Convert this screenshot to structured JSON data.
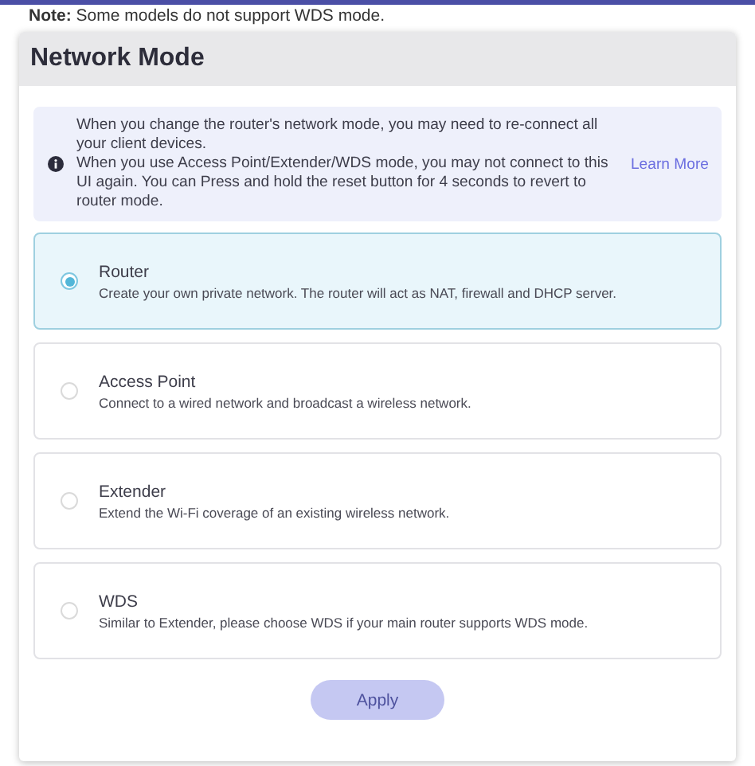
{
  "note": "**Note:** Some models do not support WDS mode.",
  "panel": {
    "title": "Network Mode"
  },
  "info": {
    "lines": [
      "When you change the router's network mode, you may need to re-connect all your client devices.",
      "When you use Access Point/Extender/WDS mode, you may not connect to this UI again. You can Press and hold the reset button for 4 seconds to revert to router mode."
    ],
    "link": "Learn More"
  },
  "modes": [
    {
      "label": "Router",
      "description": "Create your own private network. The router will act as NAT, firewall and DHCP server.",
      "selected": true
    },
    {
      "label": "Access Point",
      "description": "Connect to a wired network and broadcast a wireless network.",
      "selected": false
    },
    {
      "label": "Extender",
      "description": "Extend the Wi-Fi coverage of an existing wireless network.",
      "selected": false
    },
    {
      "label": "WDS",
      "description": "Similar to Extender, please choose WDS if your main router supports WDS mode.",
      "selected": false
    }
  ],
  "apply_button": {
    "label": "Apply",
    "disabled": true
  }
}
